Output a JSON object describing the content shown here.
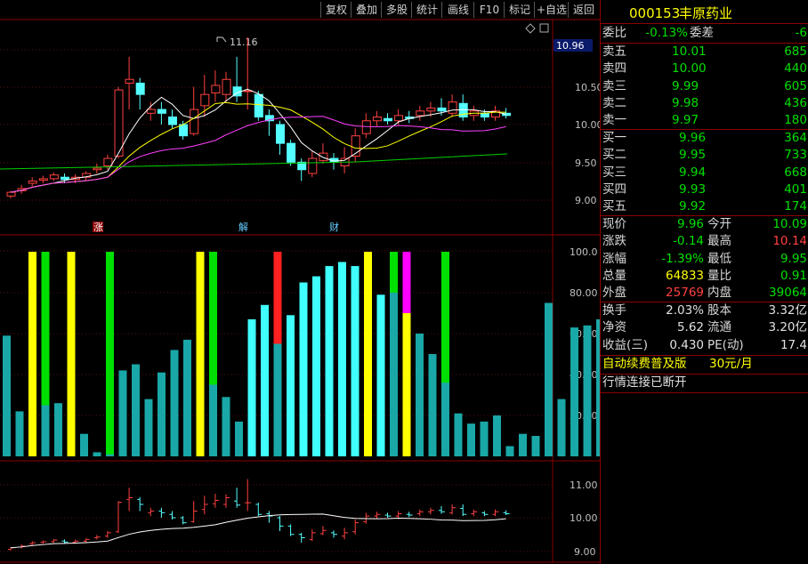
{
  "toolbar": {
    "buttons": [
      "复权",
      "叠加",
      "多股",
      "统计",
      "画线",
      "F10",
      "标记",
      "+自选",
      "返回"
    ]
  },
  "stock": {
    "code": "000153",
    "name": "丰原药业"
  },
  "price_chart": {
    "axis_labels": [
      "10.50",
      "10.00",
      "9.50",
      "9.00"
    ],
    "current_price_tag": "10.96",
    "high_annotation": "11.16",
    "event_markers": [
      "涨",
      "解",
      "财"
    ]
  },
  "indicator_chart": {
    "axis_labels": [
      "100.0",
      "80.00",
      "60.00",
      "40.00",
      "20.00"
    ]
  },
  "mini_chart": {
    "axis_labels": [
      "11.00",
      "10.00",
      "9.00"
    ]
  },
  "quote": {
    "webi": {
      "label": "委比",
      "value": "-0.13%",
      "label2": "委差",
      "value2": "-6"
    },
    "asks": [
      {
        "label": "卖五",
        "price": "10.01",
        "vol": "685"
      },
      {
        "label": "卖四",
        "price": "10.00",
        "vol": "440"
      },
      {
        "label": "卖三",
        "price": "9.99",
        "vol": "605"
      },
      {
        "label": "卖二",
        "price": "9.98",
        "vol": "436"
      },
      {
        "label": "卖一",
        "price": "9.97",
        "vol": "180"
      }
    ],
    "bids": [
      {
        "label": "买一",
        "price": "9.96",
        "vol": "364"
      },
      {
        "label": "买二",
        "price": "9.95",
        "vol": "733"
      },
      {
        "label": "买三",
        "price": "9.94",
        "vol": "668"
      },
      {
        "label": "买四",
        "price": "9.93",
        "vol": "401"
      },
      {
        "label": "买五",
        "price": "9.92",
        "vol": "174"
      }
    ],
    "stats": [
      {
        "l1": "现价",
        "v1": "9.96",
        "l2": "今开",
        "v2": "10.09"
      },
      {
        "l1": "涨跌",
        "v1": "-0.14",
        "l2": "最高",
        "v2": "10.14"
      },
      {
        "l1": "涨幅",
        "v1": "-1.39%",
        "l2": "最低",
        "v2": "9.95"
      },
      {
        "l1": "总量",
        "v1": "64833",
        "l2": "量比",
        "v2": "0.91"
      },
      {
        "l1": "外盘",
        "v1": "25769",
        "l2": "内盘",
        "v2": "39064"
      }
    ],
    "fin": [
      {
        "l1": "换手",
        "v1": "2.03%",
        "l2": "股本",
        "v2": "3.32亿"
      },
      {
        "l1": "净资",
        "v1": "5.62",
        "l2": "流通",
        "v2": "3.20亿"
      },
      {
        "l1": "收益(三)",
        "v1": "0.430",
        "l2": "PE(动)",
        "v2": "17.4"
      }
    ],
    "promo": {
      "text": "自动续费普及版",
      "price": "30元/月"
    },
    "status": "行情连接已断开"
  }
}
